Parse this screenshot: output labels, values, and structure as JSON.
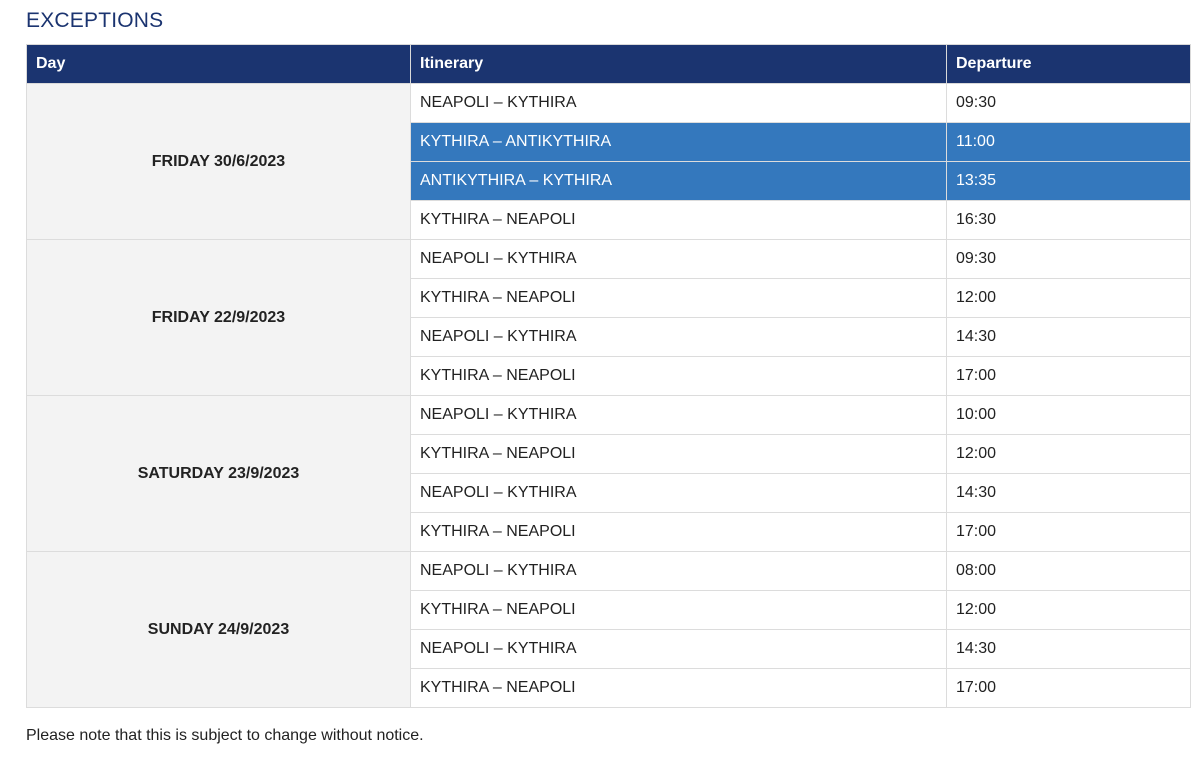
{
  "section_title": "EXCEPTIONS",
  "columns": [
    "Day",
    "Itinerary",
    "Departure"
  ],
  "colors": {
    "header_bg": "#1b3470",
    "highlight_bg": "#3478bd",
    "day_cell_bg": "#f3f3f3"
  },
  "days": [
    {
      "label": "FRIDAY 30/6/2023",
      "trips": [
        {
          "itinerary": "NEAPOLI – KYTHIRA",
          "departure": "09:30",
          "highlighted": false
        },
        {
          "itinerary": "KYTHIRA – ANTIKYTHIRA",
          "departure": "11:00",
          "highlighted": true
        },
        {
          "itinerary": "ANTIKYTHIRA – KYTHIRA",
          "departure": "13:35",
          "highlighted": true
        },
        {
          "itinerary": "KYTHIRA – NEAPOLI",
          "departure": "16:30",
          "highlighted": false
        }
      ]
    },
    {
      "label": "FRIDAY 22/9/2023",
      "trips": [
        {
          "itinerary": "NEAPOLI – KYTHIRA",
          "departure": "09:30",
          "highlighted": false
        },
        {
          "itinerary": "KYTHIRA – NEAPOLI",
          "departure": "12:00",
          "highlighted": false
        },
        {
          "itinerary": "NEAPOLI – KYTHIRA",
          "departure": "14:30",
          "highlighted": false
        },
        {
          "itinerary": "KYTHIRA – NEAPOLI",
          "departure": "17:00",
          "highlighted": false
        }
      ]
    },
    {
      "label": "SATURDAY 23/9/2023",
      "trips": [
        {
          "itinerary": "NEAPOLI – KYTHIRA",
          "departure": "10:00",
          "highlighted": false
        },
        {
          "itinerary": "KYTHIRA – NEAPOLI",
          "departure": "12:00",
          "highlighted": false
        },
        {
          "itinerary": "NEAPOLI – KYTHIRA",
          "departure": "14:30",
          "highlighted": false
        },
        {
          "itinerary": "KYTHIRA – NEAPOLI",
          "departure": "17:00",
          "highlighted": false
        }
      ]
    },
    {
      "label": "SUNDAY 24/9/2023",
      "trips": [
        {
          "itinerary": "NEAPOLI – KYTHIRA",
          "departure": "08:00",
          "highlighted": false
        },
        {
          "itinerary": "KYTHIRA – NEAPOLI",
          "departure": "12:00",
          "highlighted": false
        },
        {
          "itinerary": "NEAPOLI – KYTHIRA",
          "departure": "14:30",
          "highlighted": false
        },
        {
          "itinerary": "KYTHIRA – NEAPOLI",
          "departure": "17:00",
          "highlighted": false
        }
      ]
    }
  ],
  "note": "Please note that this is subject to change without notice."
}
